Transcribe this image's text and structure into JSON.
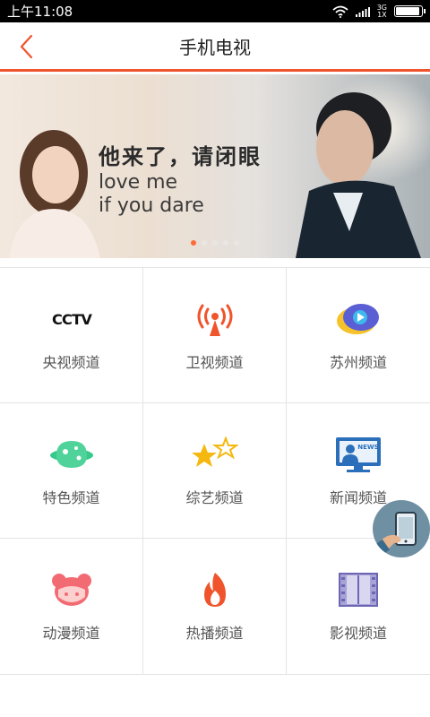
{
  "status_bar": {
    "time": "上午11:08",
    "network_top": "3G",
    "network_bottom": "1X",
    "battery_level": 0.95
  },
  "header": {
    "title": "手机电视",
    "back_icon": "chevron-left-icon"
  },
  "banner": {
    "title": "他来了，请闭眼",
    "line1": "love me",
    "line2": "if you dare",
    "active_slide": 1,
    "slide_count": 5
  },
  "channels": [
    {
      "label": "央视频道",
      "icon": "cctv-logo-icon"
    },
    {
      "label": "卫视频道",
      "icon": "broadcast-tower-icon"
    },
    {
      "label": "苏州频道",
      "icon": "play-bubble-icon"
    },
    {
      "label": "特色频道",
      "icon": "planet-icon"
    },
    {
      "label": "综艺频道",
      "icon": "stars-icon"
    },
    {
      "label": "新闻频道",
      "icon": "news-monitor-icon"
    },
    {
      "label": "动漫频道",
      "icon": "cartoon-face-icon"
    },
    {
      "label": "热播频道",
      "icon": "flame-icon"
    },
    {
      "label": "影视频道",
      "icon": "film-strip-icon"
    }
  ],
  "colors": {
    "accent": "#f0542c",
    "text": "#555555"
  }
}
